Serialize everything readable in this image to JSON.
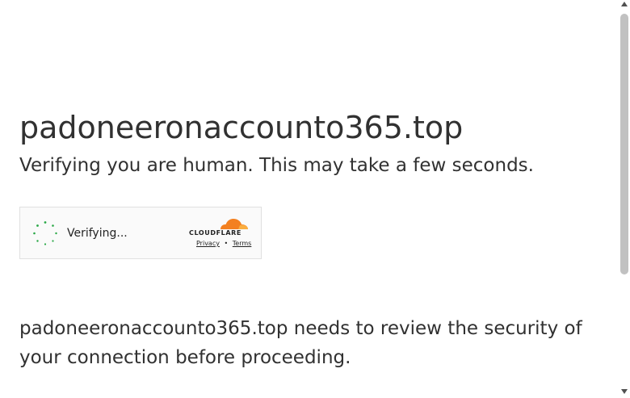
{
  "page": {
    "host_title": "padoneeronaccounto365.top",
    "subtitle": "Verifying you are human. This may take a few seconds.",
    "review_message": "padoneeronaccounto365.top needs to review the security of your connection before proceeding."
  },
  "widget": {
    "status_text": "Verifying...",
    "brand_wordmark": "CLOUDFLARE",
    "privacy_link": "Privacy",
    "separator": "•",
    "terms_link": "Terms",
    "spinner_icon": "loading-spinner-icon",
    "logo_icon": "cloudflare-cloud-icon",
    "colors": {
      "spinner": "#28a745",
      "cloud_orange": "#f38020",
      "cloud_light": "#faae40"
    }
  },
  "scrollbar": {
    "up_icon": "scroll-up-arrow-icon",
    "down_icon": "scroll-down-arrow-icon"
  }
}
